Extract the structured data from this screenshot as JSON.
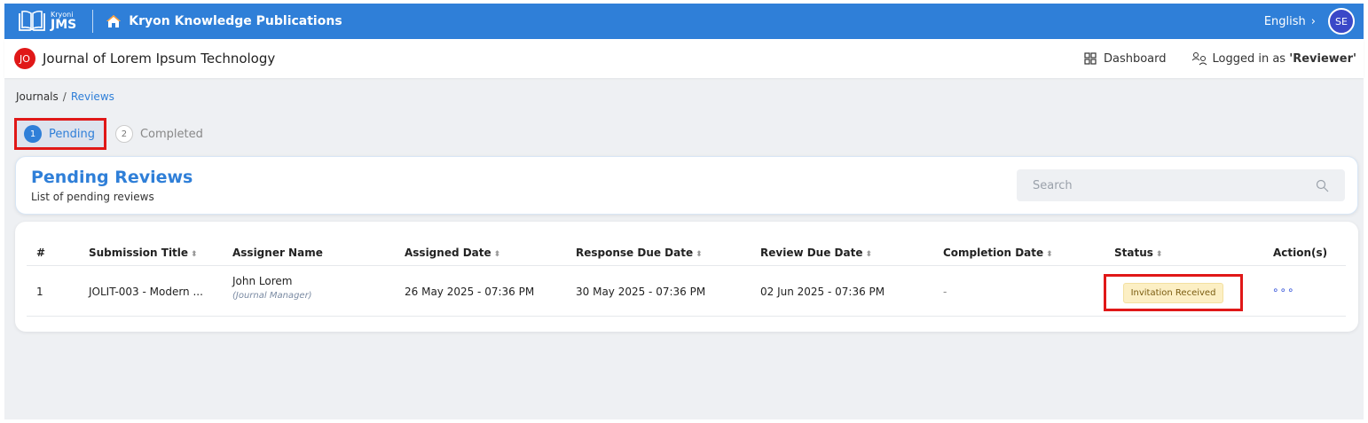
{
  "topbar": {
    "logo_small": "Kryoni",
    "logo_big": "JMS",
    "publisher": "Kryon Knowledge Publications",
    "language": "English",
    "language_chevron": "›",
    "user_initials": "SE"
  },
  "journalbar": {
    "badge": "JO",
    "title": "Journal of Lorem Ipsum Technology",
    "dashboard": "Dashboard",
    "logged_prefix": "Logged in as ",
    "logged_role": "'Reviewer'"
  },
  "breadcrumb": {
    "root": "Journals",
    "separator": "/",
    "current": "Reviews"
  },
  "steps": [
    {
      "num": "1",
      "label": "Pending"
    },
    {
      "num": "2",
      "label": "Completed"
    }
  ],
  "card": {
    "title": "Pending Reviews",
    "subtitle": "List of pending reviews",
    "search_placeholder": "Search"
  },
  "table": {
    "headers": [
      "#",
      "Submission Title",
      "Assigner Name",
      "Assigned Date",
      "Response Due Date",
      "Review Due Date",
      "Completion Date",
      "Status",
      "Action(s)"
    ],
    "sort_glyph": "⬍",
    "rows": [
      {
        "num": "1",
        "title": "JOLIT-003 - Modern ...",
        "assigner": "John Lorem",
        "assigner_role": "(Journal Manager)",
        "assigned_date": "26 May 2025 - 07:36 PM",
        "response_due": "30 May 2025 - 07:36 PM",
        "review_due": "02 Jun 2025 - 07:36 PM",
        "completion": "-",
        "status": "Invitation Received",
        "action": "∘∘∘"
      }
    ]
  },
  "colors": {
    "primary": "#2f7fd8",
    "highlight": "#e01818",
    "status_bg": "#fcefc4"
  }
}
